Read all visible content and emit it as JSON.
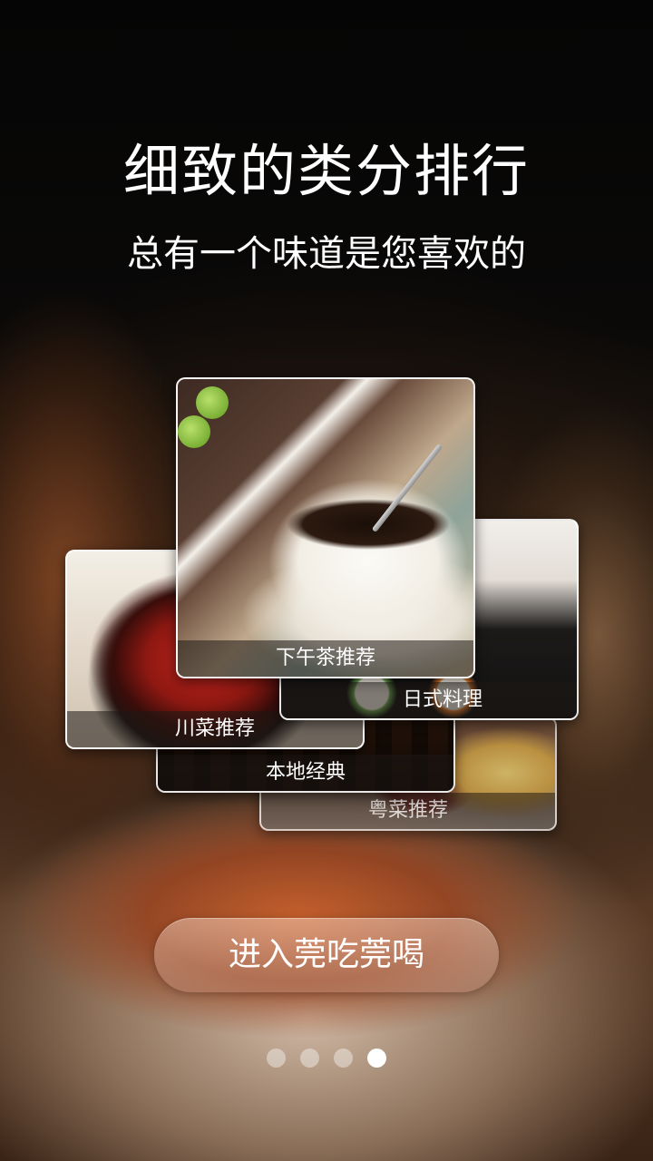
{
  "headline": "细致的类分排行",
  "subheadline": "总有一个味道是您喜欢的",
  "categories": [
    {
      "id": "yue",
      "label": "粤菜推荐"
    },
    {
      "id": "local",
      "label": "本地经典"
    },
    {
      "id": "sichuan",
      "label": "川菜推荐"
    },
    {
      "id": "japanese",
      "label": "日式料理"
    },
    {
      "id": "afternoon_tea",
      "label": "下午茶推荐"
    }
  ],
  "cta": {
    "label": "进入莞吃莞喝"
  },
  "pager": {
    "total": 4,
    "active_index": 3
  },
  "colors": {
    "text": "#ffffff",
    "dot_inactive": "rgba(255,255,255,0.4)",
    "dot_active": "#ffffff"
  }
}
